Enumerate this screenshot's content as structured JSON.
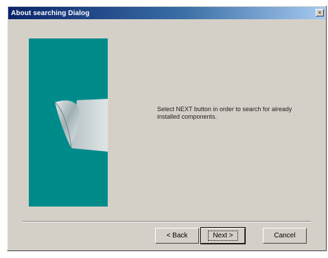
{
  "window": {
    "title": "About searching Dialog",
    "close_label": "×"
  },
  "panel": {
    "graphic_icon": "page-curl-icon",
    "colors": {
      "panel": "#008b8b",
      "dialog": "#d4d0c8"
    }
  },
  "message": "Select NEXT button in order to search for already installed components.",
  "buttons": {
    "back_label": "< Back",
    "next_label": "Next >",
    "cancel_label": "Cancel"
  }
}
